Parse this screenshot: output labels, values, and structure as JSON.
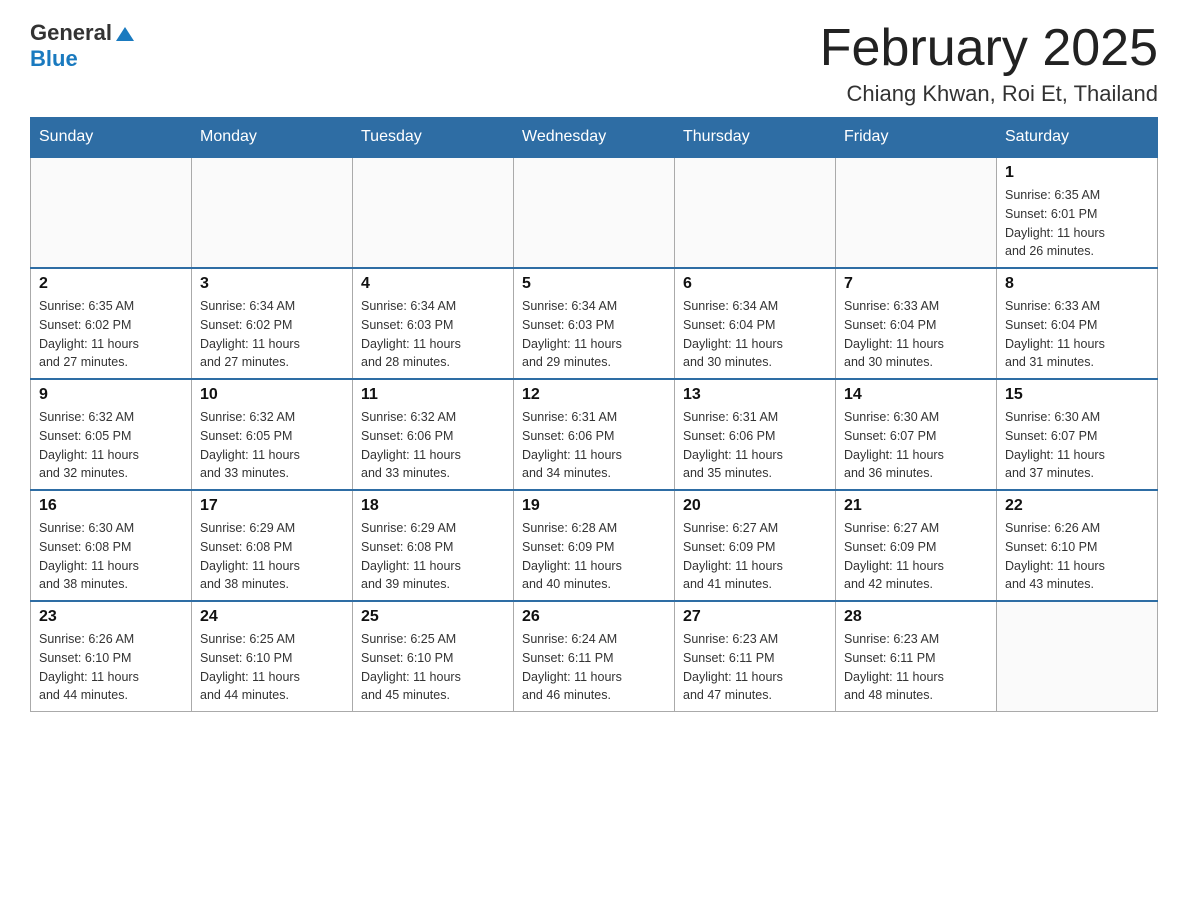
{
  "header": {
    "logo_general": "General",
    "logo_blue": "Blue",
    "title": "February 2025",
    "subtitle": "Chiang Khwan, Roi Et, Thailand"
  },
  "days_of_week": [
    "Sunday",
    "Monday",
    "Tuesday",
    "Wednesday",
    "Thursday",
    "Friday",
    "Saturday"
  ],
  "weeks": [
    [
      {
        "day": "",
        "info": ""
      },
      {
        "day": "",
        "info": ""
      },
      {
        "day": "",
        "info": ""
      },
      {
        "day": "",
        "info": ""
      },
      {
        "day": "",
        "info": ""
      },
      {
        "day": "",
        "info": ""
      },
      {
        "day": "1",
        "info": "Sunrise: 6:35 AM\nSunset: 6:01 PM\nDaylight: 11 hours\nand 26 minutes."
      }
    ],
    [
      {
        "day": "2",
        "info": "Sunrise: 6:35 AM\nSunset: 6:02 PM\nDaylight: 11 hours\nand 27 minutes."
      },
      {
        "day": "3",
        "info": "Sunrise: 6:34 AM\nSunset: 6:02 PM\nDaylight: 11 hours\nand 27 minutes."
      },
      {
        "day": "4",
        "info": "Sunrise: 6:34 AM\nSunset: 6:03 PM\nDaylight: 11 hours\nand 28 minutes."
      },
      {
        "day": "5",
        "info": "Sunrise: 6:34 AM\nSunset: 6:03 PM\nDaylight: 11 hours\nand 29 minutes."
      },
      {
        "day": "6",
        "info": "Sunrise: 6:34 AM\nSunset: 6:04 PM\nDaylight: 11 hours\nand 30 minutes."
      },
      {
        "day": "7",
        "info": "Sunrise: 6:33 AM\nSunset: 6:04 PM\nDaylight: 11 hours\nand 30 minutes."
      },
      {
        "day": "8",
        "info": "Sunrise: 6:33 AM\nSunset: 6:04 PM\nDaylight: 11 hours\nand 31 minutes."
      }
    ],
    [
      {
        "day": "9",
        "info": "Sunrise: 6:32 AM\nSunset: 6:05 PM\nDaylight: 11 hours\nand 32 minutes."
      },
      {
        "day": "10",
        "info": "Sunrise: 6:32 AM\nSunset: 6:05 PM\nDaylight: 11 hours\nand 33 minutes."
      },
      {
        "day": "11",
        "info": "Sunrise: 6:32 AM\nSunset: 6:06 PM\nDaylight: 11 hours\nand 33 minutes."
      },
      {
        "day": "12",
        "info": "Sunrise: 6:31 AM\nSunset: 6:06 PM\nDaylight: 11 hours\nand 34 minutes."
      },
      {
        "day": "13",
        "info": "Sunrise: 6:31 AM\nSunset: 6:06 PM\nDaylight: 11 hours\nand 35 minutes."
      },
      {
        "day": "14",
        "info": "Sunrise: 6:30 AM\nSunset: 6:07 PM\nDaylight: 11 hours\nand 36 minutes."
      },
      {
        "day": "15",
        "info": "Sunrise: 6:30 AM\nSunset: 6:07 PM\nDaylight: 11 hours\nand 37 minutes."
      }
    ],
    [
      {
        "day": "16",
        "info": "Sunrise: 6:30 AM\nSunset: 6:08 PM\nDaylight: 11 hours\nand 38 minutes."
      },
      {
        "day": "17",
        "info": "Sunrise: 6:29 AM\nSunset: 6:08 PM\nDaylight: 11 hours\nand 38 minutes."
      },
      {
        "day": "18",
        "info": "Sunrise: 6:29 AM\nSunset: 6:08 PM\nDaylight: 11 hours\nand 39 minutes."
      },
      {
        "day": "19",
        "info": "Sunrise: 6:28 AM\nSunset: 6:09 PM\nDaylight: 11 hours\nand 40 minutes."
      },
      {
        "day": "20",
        "info": "Sunrise: 6:27 AM\nSunset: 6:09 PM\nDaylight: 11 hours\nand 41 minutes."
      },
      {
        "day": "21",
        "info": "Sunrise: 6:27 AM\nSunset: 6:09 PM\nDaylight: 11 hours\nand 42 minutes."
      },
      {
        "day": "22",
        "info": "Sunrise: 6:26 AM\nSunset: 6:10 PM\nDaylight: 11 hours\nand 43 minutes."
      }
    ],
    [
      {
        "day": "23",
        "info": "Sunrise: 6:26 AM\nSunset: 6:10 PM\nDaylight: 11 hours\nand 44 minutes."
      },
      {
        "day": "24",
        "info": "Sunrise: 6:25 AM\nSunset: 6:10 PM\nDaylight: 11 hours\nand 44 minutes."
      },
      {
        "day": "25",
        "info": "Sunrise: 6:25 AM\nSunset: 6:10 PM\nDaylight: 11 hours\nand 45 minutes."
      },
      {
        "day": "26",
        "info": "Sunrise: 6:24 AM\nSunset: 6:11 PM\nDaylight: 11 hours\nand 46 minutes."
      },
      {
        "day": "27",
        "info": "Sunrise: 6:23 AM\nSunset: 6:11 PM\nDaylight: 11 hours\nand 47 minutes."
      },
      {
        "day": "28",
        "info": "Sunrise: 6:23 AM\nSunset: 6:11 PM\nDaylight: 11 hours\nand 48 minutes."
      },
      {
        "day": "",
        "info": ""
      }
    ]
  ]
}
